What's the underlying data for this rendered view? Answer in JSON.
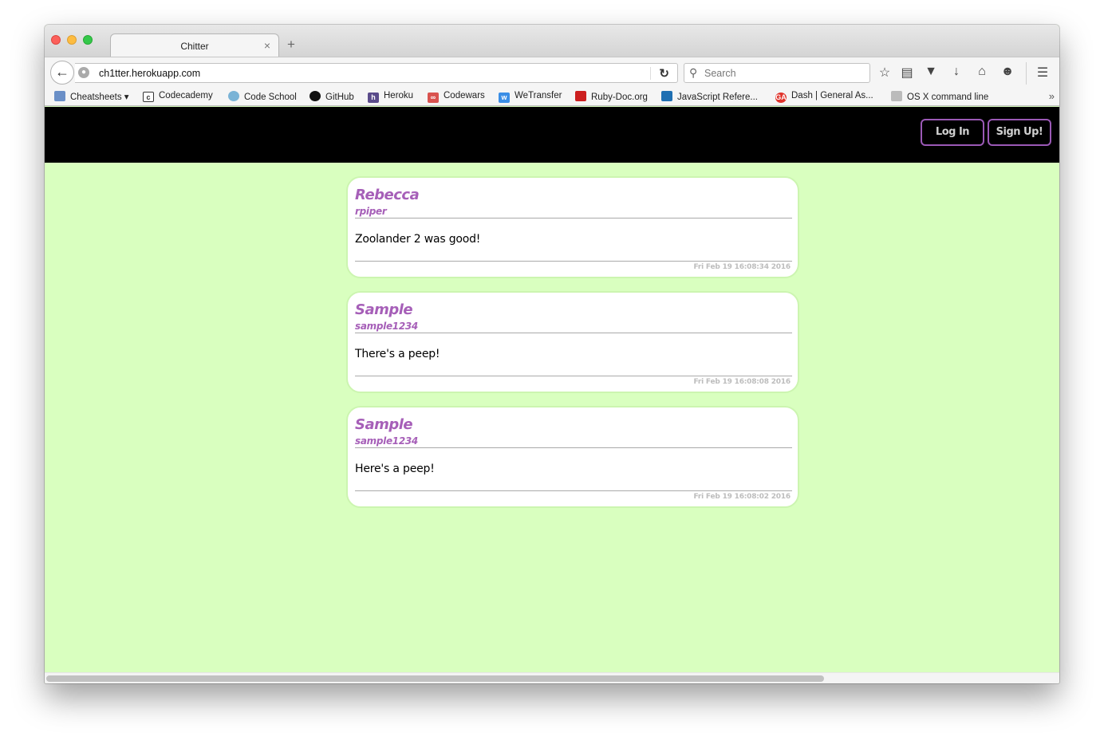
{
  "browser": {
    "tab_title": "Chitter",
    "tab_close": "×",
    "new_tab": "+",
    "url": "ch1tter.herokuapp.com",
    "search_placeholder": "Search"
  },
  "bookmarks": [
    {
      "label": "Cheatsheets",
      "icon": "folder-icon",
      "color": "#6a8fc7"
    },
    {
      "label": "Codecademy",
      "icon": "codecademy-icon",
      "color": "#333333"
    },
    {
      "label": "Code School",
      "icon": "codeschool-icon",
      "color": "#7ab3d6"
    },
    {
      "label": "GitHub",
      "icon": "github-icon",
      "color": "#111111"
    },
    {
      "label": "Heroku",
      "icon": "heroku-icon",
      "color": "#5a4b8a"
    },
    {
      "label": "Codewars",
      "icon": "codewars-icon",
      "color": "#d9534f"
    },
    {
      "label": "WeTransfer",
      "icon": "wetransfer-icon",
      "color": "#3a8ee6"
    },
    {
      "label": "Ruby-Doc.org",
      "icon": "rubydoc-icon",
      "color": "#cc1f1f"
    },
    {
      "label": "JavaScript Refere...",
      "icon": "mdn-icon",
      "color": "#1f6fb2"
    },
    {
      "label": "Dash | General As...",
      "icon": "ga-icon",
      "color": "#e0332b"
    },
    {
      "label": "OS X command line",
      "icon": "page-icon",
      "color": "#bbbbbb"
    }
  ],
  "header": {
    "login_label": "Log In",
    "signup_label": "Sign Up!"
  },
  "peeps": [
    {
      "name": "Rebecca",
      "handle": "rpiper",
      "body": "Zoolander 2 was good!",
      "time": "Fri Feb 19 16:08:34 2016"
    },
    {
      "name": "Sample",
      "handle": "sample1234",
      "body": "There's a peep!",
      "time": "Fri Feb 19 16:08:08 2016"
    },
    {
      "name": "Sample",
      "handle": "sample1234",
      "body": "Here's a peep!",
      "time": "Fri Feb 19 16:08:02 2016"
    }
  ],
  "colors": {
    "page_background": "#d9ffbf",
    "header_background": "#000000",
    "accent_purple": "#a65fb8"
  }
}
